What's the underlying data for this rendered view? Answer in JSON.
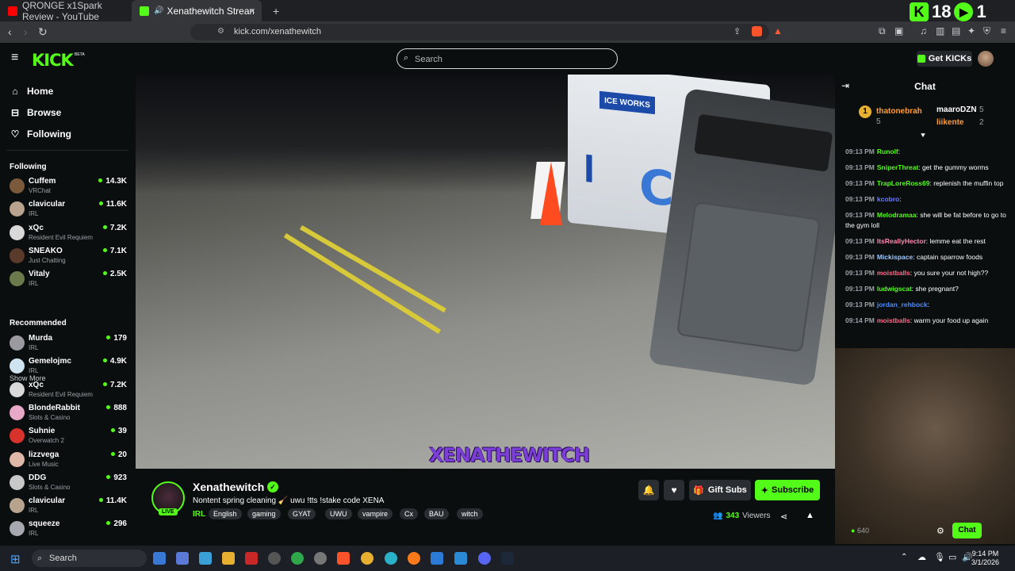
{
  "browser": {
    "tabs": [
      {
        "title": "QRONGE x1Spark Review - YouTube"
      },
      {
        "title": "Xenathewitch Stream - Watc"
      }
    ],
    "url": "kick.com/xenathewitch",
    "new_tab": "+",
    "close": "×",
    "overlay_count_1": "18",
    "overlay_count_2": "1"
  },
  "header": {
    "logo": "KICK",
    "beta": "BETA",
    "search_placeholder": "Search",
    "get_kicks": "Get KICKs"
  },
  "sidebar": {
    "nav": [
      {
        "label": "Home"
      },
      {
        "label": "Browse"
      },
      {
        "label": "Following"
      }
    ],
    "following_title": "Following",
    "following": [
      {
        "name": "Cuffem",
        "category": "VRChat",
        "viewers": "14.3K",
        "color": "#7a5a3a"
      },
      {
        "name": "clavicular",
        "category": "IRL",
        "viewers": "11.6K",
        "color": "#b8a48e"
      },
      {
        "name": "xQc",
        "category": "Resident Evil Requiem",
        "viewers": "7.2K",
        "color": "#d9d9d9"
      },
      {
        "name": "SNEAKO",
        "category": "Just Chatting",
        "viewers": "7.1K",
        "color": "#5a3a2a"
      },
      {
        "name": "Vitaly",
        "category": "IRL",
        "viewers": "2.5K",
        "color": "#6b7a4a"
      }
    ],
    "show_more": "Show More",
    "recommended_title": "Recommended",
    "recommended": [
      {
        "name": "Murda",
        "category": "IRL",
        "viewers": "179",
        "color": "#9a9aa0"
      },
      {
        "name": "Gemelojmc",
        "category": "IRL",
        "viewers": "4.9K",
        "color": "#cfe3f0"
      },
      {
        "name": "xQc",
        "category": "Resident Evil Requiem",
        "viewers": "7.2K",
        "color": "#d9d9d9"
      },
      {
        "name": "BlondeRabbit",
        "category": "Slots & Casino",
        "viewers": "888",
        "color": "#e8a8c8"
      },
      {
        "name": "Suhnie",
        "category": "Overwatch 2",
        "viewers": "39",
        "color": "#d8322c"
      },
      {
        "name": "lizzvega",
        "category": "Live Music",
        "viewers": "20",
        "color": "#e0b8a8"
      },
      {
        "name": "DDG",
        "category": "Slots & Casino",
        "viewers": "923",
        "color": "#c8c8c8"
      },
      {
        "name": "clavicular",
        "category": "IRL",
        "viewers": "11.4K",
        "color": "#b8a48e"
      },
      {
        "name": "squeeze",
        "category": "IRL",
        "viewers": "296",
        "color": "#a8a8b0"
      }
    ]
  },
  "video": {
    "watermark": "XENATHEWITCH",
    "sign_text": "ICE WORKS"
  },
  "stream": {
    "name": "Xenathewitch",
    "live": "LIVE",
    "title": "Nontent spring cleaning 🧹 uwu !tts !stake code XENA",
    "category": "IRL",
    "tags": [
      "English",
      "gaming",
      "GYAT",
      "UWU",
      "vampire",
      "Cx",
      "BAU",
      "witch"
    ],
    "gift_subs": "Gift Subs",
    "subscribe": "Subscribe",
    "viewers": "343",
    "viewers_label": "Viewers"
  },
  "chat": {
    "title": "Chat",
    "gifters": [
      {
        "name": "thatonebrah",
        "count": "5",
        "rank": "1",
        "color": "#ff9d3b"
      },
      {
        "name": "maaroDZN",
        "count": "5",
        "color": "#ffffff"
      },
      {
        "name": "liikente",
        "count": "2",
        "color": "#ff9d3b"
      }
    ],
    "messages": [
      {
        "time": "09:13 PM",
        "user": "Runolf",
        "text": "",
        "color": "#53fc18"
      },
      {
        "time": "09:13 PM",
        "user": "SniperThreat",
        "text": "get the gummy worms",
        "color": "#53fc18"
      },
      {
        "time": "09:13 PM",
        "user": "TrapLoreRoss69",
        "text": "replenish the muffin top",
        "color": "#53fc18"
      },
      {
        "time": "09:13 PM",
        "user": "kcobro",
        "text": "",
        "color": "#6b7cff"
      },
      {
        "time": "09:13 PM",
        "user": "Melodramaa",
        "text": "she will be fat before to go to the gym loll",
        "color": "#53fc18"
      },
      {
        "time": "09:13 PM",
        "user": "ItsReallyHector",
        "text": "lemme eat the rest",
        "color": "#ff8ab0"
      },
      {
        "time": "09:13 PM",
        "user": "Mickispace",
        "text": "captain sparrow foods",
        "color": "#9cc8ff"
      },
      {
        "time": "09:13 PM",
        "user": "moistballs",
        "text": "you sure your not high??",
        "color": "#ff6b8a"
      },
      {
        "time": "09:13 PM",
        "user": "ludwigscat",
        "text": "she pregnant?",
        "color": "#53fc18"
      },
      {
        "time": "09:13 PM",
        "user": "jordan_rehbock",
        "text": "",
        "color": "#4a8cff"
      },
      {
        "time": "09:14 PM",
        "user": "moistballs",
        "text": "warm your food up again",
        "color": "#ff6b8a"
      }
    ],
    "points": "640",
    "send": "Chat"
  },
  "taskbar": {
    "search": "Search",
    "time": "9:14 PM",
    "date": "3/1/2026"
  }
}
